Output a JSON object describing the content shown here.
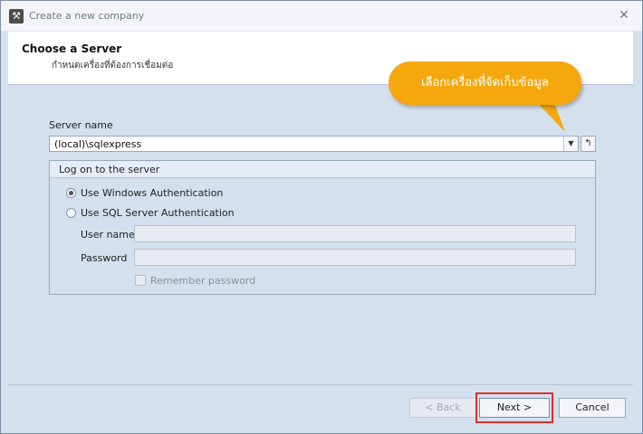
{
  "window": {
    "title": "Create a new company"
  },
  "header": {
    "title": "Choose a Server",
    "subtitle": "กำหนดเครื่องที่ต้องการเชื่อมต่อ"
  },
  "callout": {
    "text": "เลือกเครื่องที่จัดเก็บข้อมูล"
  },
  "server": {
    "label": "Server name",
    "value": "(local)\\sqlexpress"
  },
  "logon": {
    "group_title": "Log on to the server",
    "windows_auth": "Use Windows Authentication",
    "sql_auth": "Use SQL Server Authentication",
    "username_label": "User name",
    "password_label": "Password",
    "remember_label": "Remember password",
    "selected": "windows"
  },
  "footer": {
    "back": "< Back",
    "next": "Next >",
    "cancel": "Cancel"
  },
  "colors": {
    "callout": "#f4a80d",
    "highlight": "#e0302a",
    "background": "#d5e0ee"
  }
}
